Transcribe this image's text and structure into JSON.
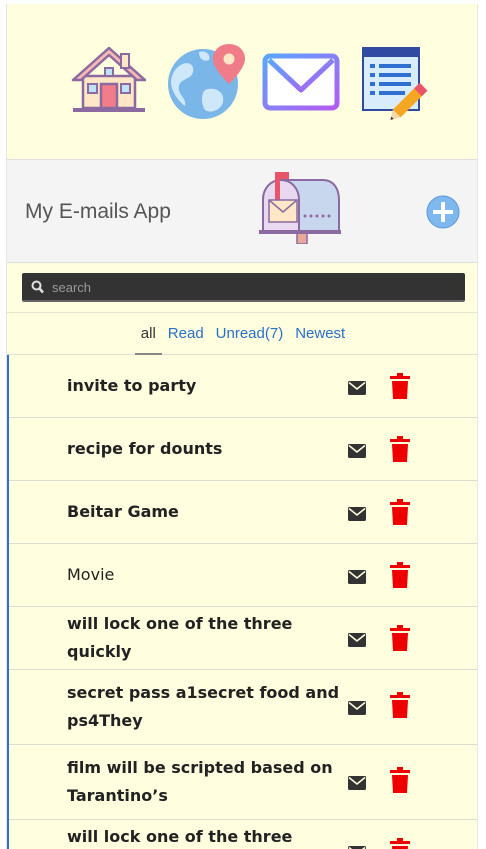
{
  "nav": {
    "icons": [
      "home-icon",
      "globe-location-icon",
      "mail-icon",
      "notepad-edit-icon"
    ]
  },
  "header": {
    "title": "My E-mails App",
    "mailbox_icon": "mailbox-icon",
    "add_icon": "add-circle-icon"
  },
  "search": {
    "placeholder": "search",
    "value": ""
  },
  "tabs": [
    {
      "label": "all",
      "active": true
    },
    {
      "label": "Read",
      "active": false
    },
    {
      "label": "Unread(7)",
      "active": false
    },
    {
      "label": "Newest",
      "active": false
    }
  ],
  "emails": [
    {
      "subject": "invite to party",
      "unread": true
    },
    {
      "subject": "recipe for dounts",
      "unread": true
    },
    {
      "subject": "Beitar Game",
      "unread": true
    },
    {
      "subject": "Movie",
      "unread": false
    },
    {
      "subject": "will lock one of the three quickly",
      "unread": true
    },
    {
      "subject": "secret pass a1secret food and ps4They",
      "unread": true
    },
    {
      "subject": "film will be scripted based on Tarantino’s",
      "unread": true
    },
    {
      "subject": "will lock one of the three quickly",
      "unread": true
    }
  ],
  "colors": {
    "background": "#fffede",
    "trash": "#ee0000",
    "link": "#2a6fc9",
    "search_bg": "#333333"
  }
}
